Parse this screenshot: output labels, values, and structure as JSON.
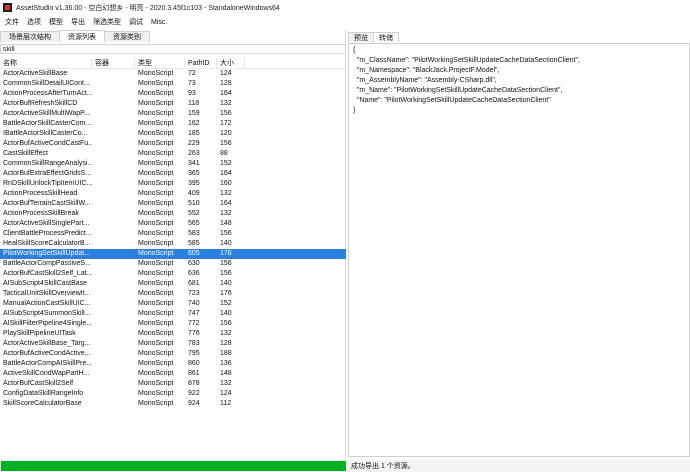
{
  "window": {
    "title": "AssetStudio v1.36.00 - 空白幻想乡 - 明亮 - 2020.3.45f1c103 - StandaloneWindows64"
  },
  "menu": [
    "文件",
    "选项",
    "模型",
    "导出",
    "筛选类型",
    "调试",
    "Misc."
  ],
  "left_tabs": [
    {
      "label": "场景层次结构",
      "active": false
    },
    {
      "label": "资源列表",
      "active": true
    },
    {
      "label": "资源类别",
      "active": false
    }
  ],
  "filter": {
    "value": "skill",
    "placeholder": ""
  },
  "columns": [
    "名称",
    "容器",
    "类型",
    "PathID",
    "大小"
  ],
  "rows": [
    [
      "ActorActiveSkillBase",
      "",
      "MonoScript",
      "72",
      "124"
    ],
    [
      "CommonSkillDetailUICont...",
      "",
      "MonoScript",
      "73",
      "128"
    ],
    [
      "ActionProcessAfterTurnAct...",
      "",
      "MonoScript",
      "93",
      "164"
    ],
    [
      "ActorBufRefreshSkillCD",
      "",
      "MonoScript",
      "118",
      "132"
    ],
    [
      "ActorActiveSkillMultiWapP...",
      "",
      "MonoScript",
      "159",
      "156"
    ],
    [
      "BattleActorSkillCasterCom...",
      "",
      "MonoScript",
      "162",
      "172"
    ],
    [
      "IBattleActorSkillCasterCo...",
      "",
      "MonoScript",
      "185",
      "120"
    ],
    [
      "ActorBufActiveCondCastFu...",
      "",
      "MonoScript",
      "229",
      "156"
    ],
    [
      "CastSkillEffect",
      "",
      "MonoScript",
      "263",
      "88"
    ],
    [
      "CommonSkillRangeAnalysi...",
      "",
      "MonoScript",
      "341",
      "152"
    ],
    [
      "ActorBufExtraEffectGridsS...",
      "",
      "MonoScript",
      "365",
      "164"
    ],
    [
      "RnDSkillUnlockTipItemUIC...",
      "",
      "MonoScript",
      "395",
      "160"
    ],
    [
      "ActionProcessSkillHead",
      "",
      "MonoScript",
      "409",
      "132"
    ],
    [
      "ActorBufTerrainCastSkillW...",
      "",
      "MonoScript",
      "510",
      "164"
    ],
    [
      "ActionProcessSkillBreak",
      "",
      "MonoScript",
      "552",
      "132"
    ],
    [
      "ActorActiveSkillSinglePart...",
      "",
      "MonoScript",
      "565",
      "148"
    ],
    [
      "ClientBattleProcessPredict...",
      "",
      "MonoScript",
      "583",
      "156"
    ],
    [
      "HealSkillScoreCalculatorB...",
      "",
      "MonoScript",
      "585",
      "140"
    ],
    [
      "PilotWorkingSetSkillUpdat...",
      "",
      "MonoScript",
      "605",
      "176"
    ],
    [
      "BattleActorCompPassiveS...",
      "",
      "MonoScript",
      "630",
      "156"
    ],
    [
      "ActorBufCastSkill2Self_Lat...",
      "",
      "MonoScript",
      "636",
      "156"
    ],
    [
      "AISubScript4SkillCastBase",
      "",
      "MonoScript",
      "681",
      "140"
    ],
    [
      "TacticalUnitSkillOverviewIt...",
      "",
      "MonoScript",
      "723",
      "176"
    ],
    [
      "ManualActionCastSkillUIC...",
      "",
      "MonoScript",
      "740",
      "152"
    ],
    [
      "AISubScript4SummonSkill...",
      "",
      "MonoScript",
      "747",
      "140"
    ],
    [
      "AISkillFilterPipeline4Single...",
      "",
      "MonoScript",
      "772",
      "156"
    ],
    [
      "PlaySkillPipelineUITask",
      "",
      "MonoScript",
      "776",
      "132"
    ],
    [
      "ActorActiveSkillBase_Targ...",
      "",
      "MonoScript",
      "783",
      "128"
    ],
    [
      "ActorBufActiveCondActive...",
      "",
      "MonoScript",
      "795",
      "188"
    ],
    [
      "BattleActorCompAISkillPre...",
      "",
      "MonoScript",
      "860",
      "136"
    ],
    [
      "ActiveSkillCondWapPartH...",
      "",
      "MonoScript",
      "861",
      "148"
    ],
    [
      "ActorBufCastSkill2Self",
      "",
      "MonoScript",
      "878",
      "132"
    ],
    [
      "ConfigDataSkillRangeInfo",
      "",
      "MonoScript",
      "922",
      "124"
    ],
    [
      "SkillScoreCalculatorBase",
      "",
      "MonoScript",
      "924",
      "112"
    ]
  ],
  "selected_row": 18,
  "right_tabs": [
    {
      "label": "预览",
      "active": false
    },
    {
      "label": "转储",
      "active": true
    }
  ],
  "dump_lines": [
    "{",
    "  \"m_ClassName\": \"PilotWorkingSetSkillUpdateCacheDataSectionClient\",",
    "  \"m_Namespace\": \"BlackJack.ProjectF.Model\",",
    "  \"m_AssemblyName\": \"Assembly-CSharp.dll\",",
    "  \"m_Name\": \"PilotWorkingSetSkillUpdateCacheDataSectionClient\",",
    "  \"Name\": \"PilotWorkingSetSkillUpdateCacheDataSectionClient\"",
    "}"
  ],
  "status": {
    "text": "成功导出 1 个资源。",
    "progress_fraction": 1.0,
    "progress_color": "#06b025"
  },
  "colors": {
    "selection": "#2b7fdf"
  }
}
